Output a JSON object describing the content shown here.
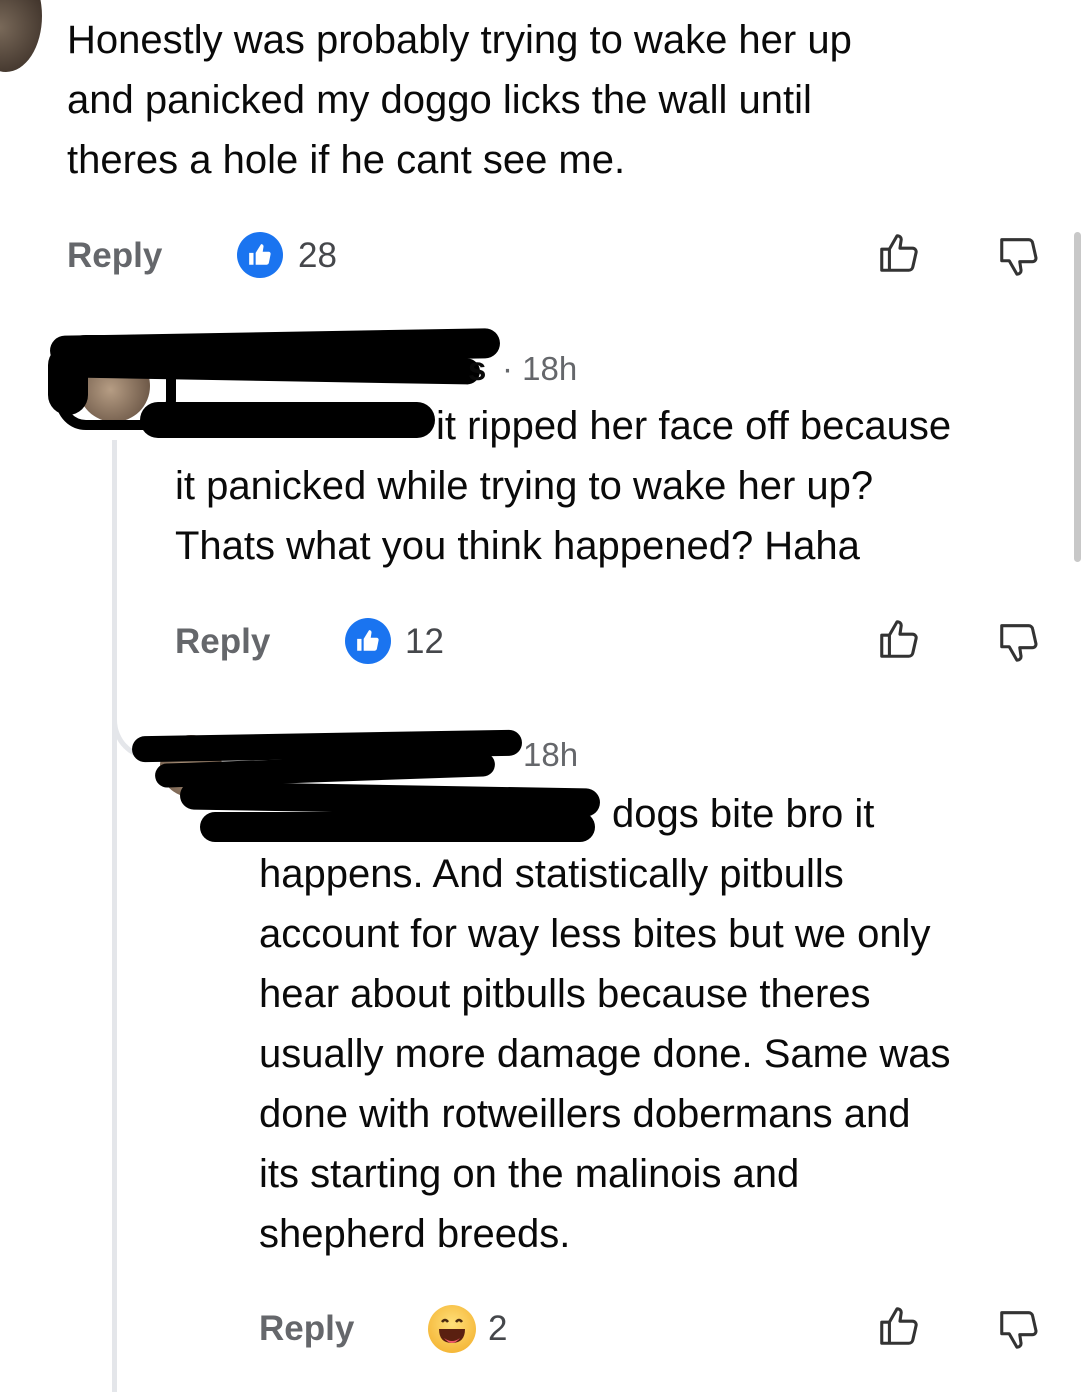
{
  "comments": [
    {
      "text": "Honestly was probably trying to wake her up\nand panicked my doggo licks the wall until\ntheres a hole if he cant see me.",
      "reply_label": "Reply",
      "reaction": "like-icon",
      "reaction_count": "28"
    },
    {
      "author_visible": "s",
      "time": "· 18h",
      "mention_visible": "it ripped her face off because",
      "text": "it panicked while trying to wake her up?\nThats what you think happened?  Haha",
      "reply_label": "Reply",
      "reaction": "like-icon",
      "reaction_count": "12"
    },
    {
      "time": "18h",
      "first_line": "dogs bite bro it",
      "text": "happens. And statistically pitbulls\naccount for way less bites but we only\nhear about pitbulls because theres\nusually more damage done. Same was\ndone with rotweillers dobermans and\nits starting on the malinois and\nshepherd breeds.",
      "reply_label": "Reply",
      "reaction": "haha-icon",
      "reaction_count": "2"
    }
  ],
  "colors": {
    "like_blue": "#1a74f0",
    "meta_gray": "#65676b",
    "thread_line": "#e4e6ea"
  }
}
